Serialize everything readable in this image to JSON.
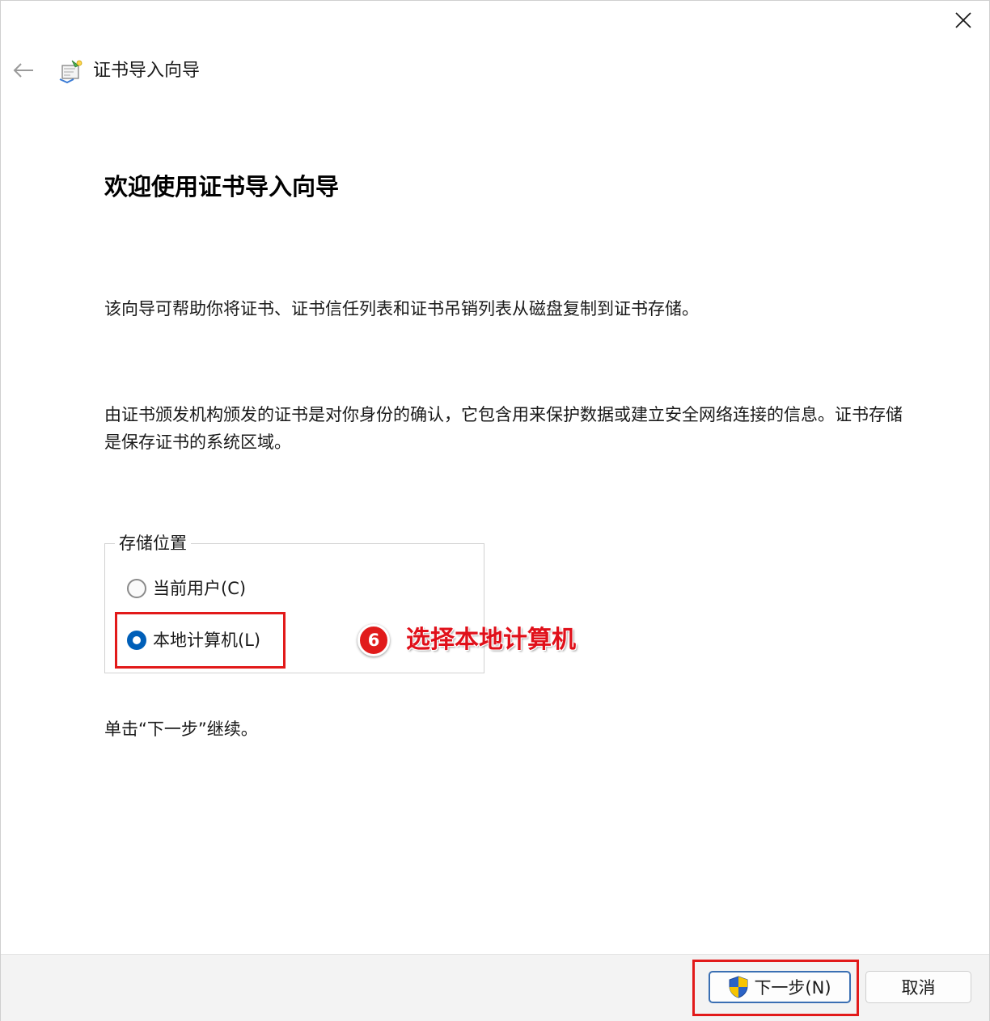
{
  "window": {
    "title": "证书导入向导"
  },
  "main": {
    "heading": "欢迎使用证书导入向导",
    "intro": "该向导可帮助你将证书、证书信任列表和证书吊销列表从磁盘复制到证书存储。",
    "description": "由证书颁发机构颁发的证书是对你身份的确认，它包含用来保护数据或建立安全网络连接的信息。证书存储是保存证书的系统区域。",
    "store_location": {
      "legend": "存储位置",
      "options": [
        {
          "label": "当前用户(C)",
          "checked": false
        },
        {
          "label": "本地计算机(L)",
          "checked": true
        }
      ]
    },
    "continue_hint": "单击“下一步”继续。"
  },
  "annotation": {
    "step_number": "6",
    "text": "选择本地计算机"
  },
  "footer": {
    "next_label": "下一步(N)",
    "cancel_label": "取消"
  },
  "colors": {
    "accent": "#005fb8",
    "highlight": "#e21a1a",
    "annotation": "#e0101a"
  }
}
